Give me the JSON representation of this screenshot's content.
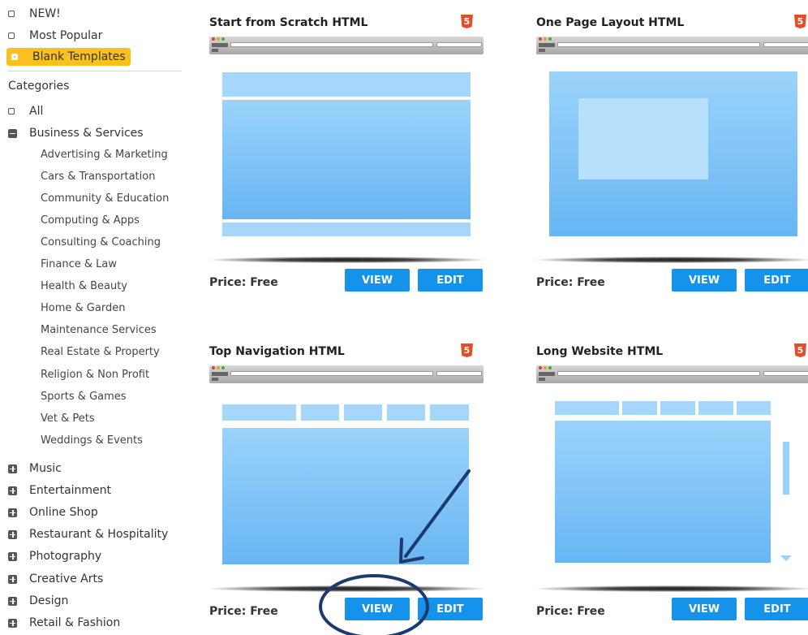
{
  "filters": [
    {
      "label": "NEW!",
      "active": false
    },
    {
      "label": "Most Popular",
      "active": false
    },
    {
      "label": "Blank Templates",
      "active": true
    }
  ],
  "categories_heading": "Categories",
  "categories": {
    "all": "All",
    "business": "Business & Services",
    "business_sub": [
      "Advertising & Marketing",
      "Cars & Transportation",
      "Community & Education",
      "Computing & Apps",
      "Consulting & Coaching",
      "Finance & Law",
      "Health & Beauty",
      "Home & Garden",
      "Maintenance Services",
      "Real Estate & Property",
      "Religion & Non Profit",
      "Sports & Games",
      "Vet & Pets",
      "Weddings & Events"
    ],
    "others": [
      "Music",
      "Entertainment",
      "Online Shop",
      "Restaurant & Hospitality",
      "Photography",
      "Creative Arts",
      "Design",
      "Retail & Fashion"
    ]
  },
  "templates": [
    {
      "title": "Start from Scratch HTML",
      "price": "Price: Free",
      "view": "VIEW",
      "edit": "EDIT",
      "badge": "5"
    },
    {
      "title": "One Page Layout HTML",
      "price": "Price: Free",
      "view": "VIEW",
      "edit": "EDIT",
      "badge": "5"
    },
    {
      "title": "Top Navigation HTML",
      "price": "Price: Free",
      "view": "VIEW",
      "edit": "EDIT",
      "badge": "5"
    },
    {
      "title": "Long Website HTML",
      "price": "Price: Free",
      "view": "VIEW",
      "edit": "EDIT",
      "badge": "5"
    }
  ],
  "colors": {
    "accent_yellow": "#f9c01e",
    "button_blue": "#1592ea",
    "preview_blue": "#7cc4f6",
    "html5_orange": "#e44d26",
    "annotation_navy": "#1d3a6e"
  }
}
